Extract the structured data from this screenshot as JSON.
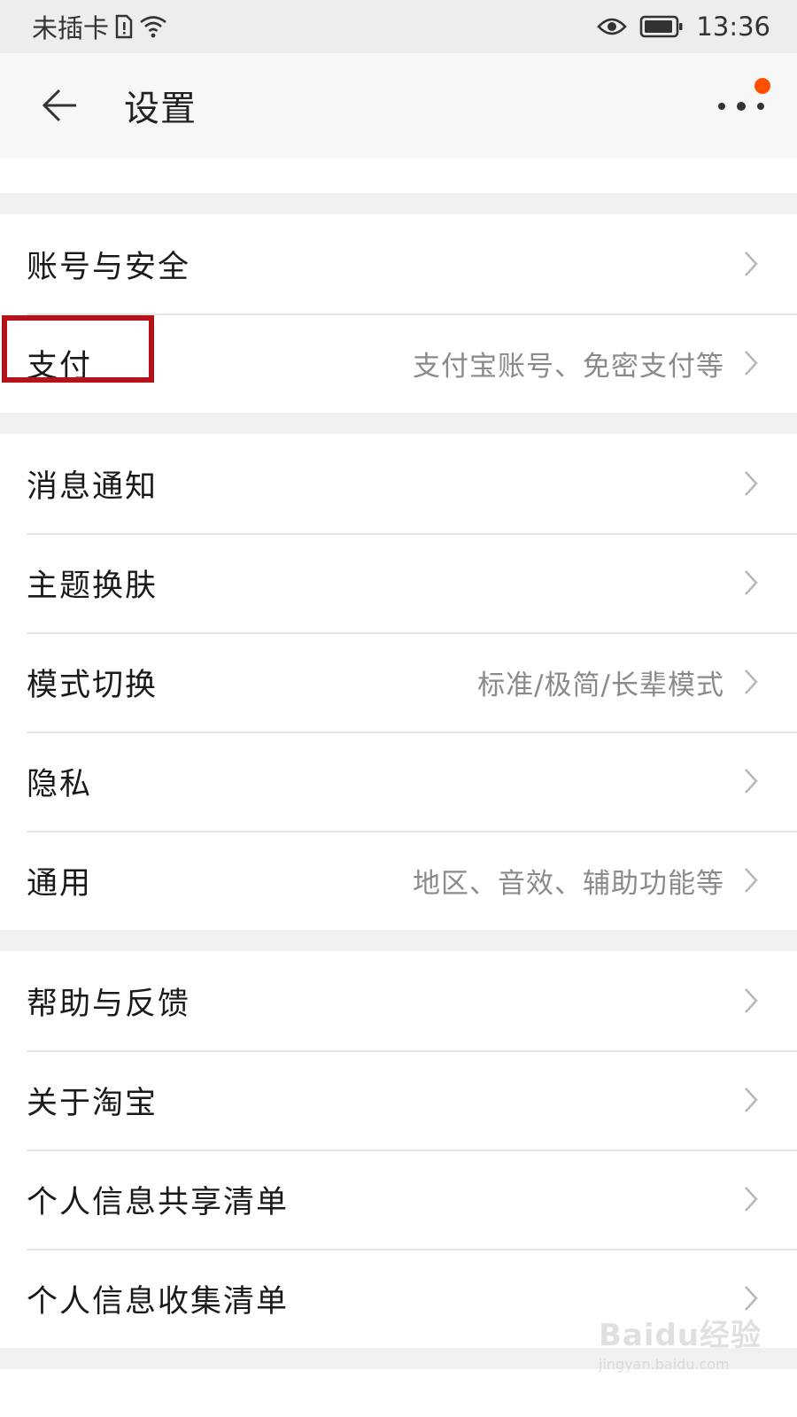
{
  "status_bar": {
    "carrier": "未插卡",
    "time": "13:36",
    "icons": [
      "sim-alert-icon",
      "wifi-icon",
      "eye-icon",
      "battery-icon"
    ]
  },
  "header": {
    "title": "设置",
    "back_icon": "back-arrow-icon",
    "more_icon": "more-dots-icon",
    "notification_dot_color": "#ff5000"
  },
  "groups": [
    {
      "items": [
        {
          "label": "账号与安全",
          "value": ""
        },
        {
          "label": "支付",
          "value": "支付宝账号、免密支付等"
        }
      ]
    },
    {
      "items": [
        {
          "label": "消息通知",
          "value": ""
        },
        {
          "label": "主题换肤",
          "value": ""
        },
        {
          "label": "模式切换",
          "value": "标准/极简/长辈模式"
        },
        {
          "label": "隐私",
          "value": ""
        },
        {
          "label": "通用",
          "value": "地区、音效、辅助功能等"
        }
      ]
    },
    {
      "items": [
        {
          "label": "帮助与反馈",
          "value": ""
        },
        {
          "label": "关于淘宝",
          "value": ""
        },
        {
          "label": "个人信息共享清单",
          "value": ""
        },
        {
          "label": "个人信息收集清单",
          "value": ""
        }
      ]
    }
  ],
  "highlight_color": "#b5121b",
  "watermark": {
    "main": "Baidu经验",
    "sub": "jingyan.baidu.com"
  }
}
